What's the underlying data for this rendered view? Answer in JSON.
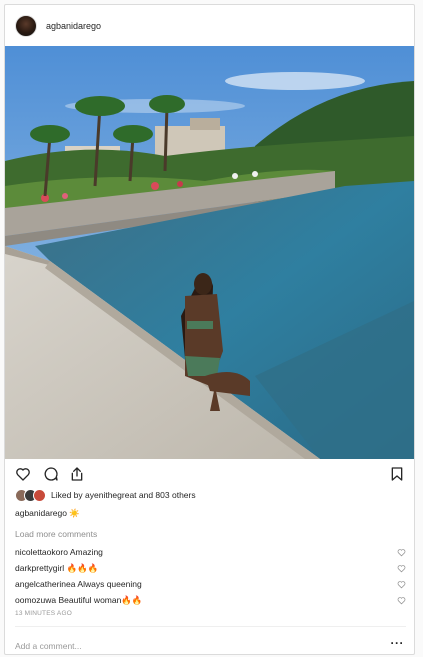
{
  "post": {
    "username": "agbanidarego",
    "likes_text": "Liked by ayenithegreat and 803 others",
    "caption_user": "agbanidarego",
    "caption_text": "☀️",
    "load_more": "Load more comments",
    "comments": [
      {
        "user": "nicolettaokoro",
        "text": "Amazing"
      },
      {
        "user": "darkprettygirl",
        "text": "🔥🔥🔥"
      },
      {
        "user": "angelcatherinea",
        "text": "Always queening"
      },
      {
        "user": "oomozuwa",
        "text": "Beautiful woman🔥🔥"
      }
    ],
    "timestamp": "13 MINUTES AGO",
    "add_comment_placeholder": "Add a comment...",
    "more_label": "···"
  },
  "icons": {
    "like": "heart-icon",
    "comment": "comment-icon",
    "share": "share-icon",
    "save": "bookmark-icon",
    "comment_like": "heart-icon"
  },
  "colors": {
    "border": "#dbdbdb",
    "text": "#262626",
    "muted": "#8e8e8e"
  }
}
